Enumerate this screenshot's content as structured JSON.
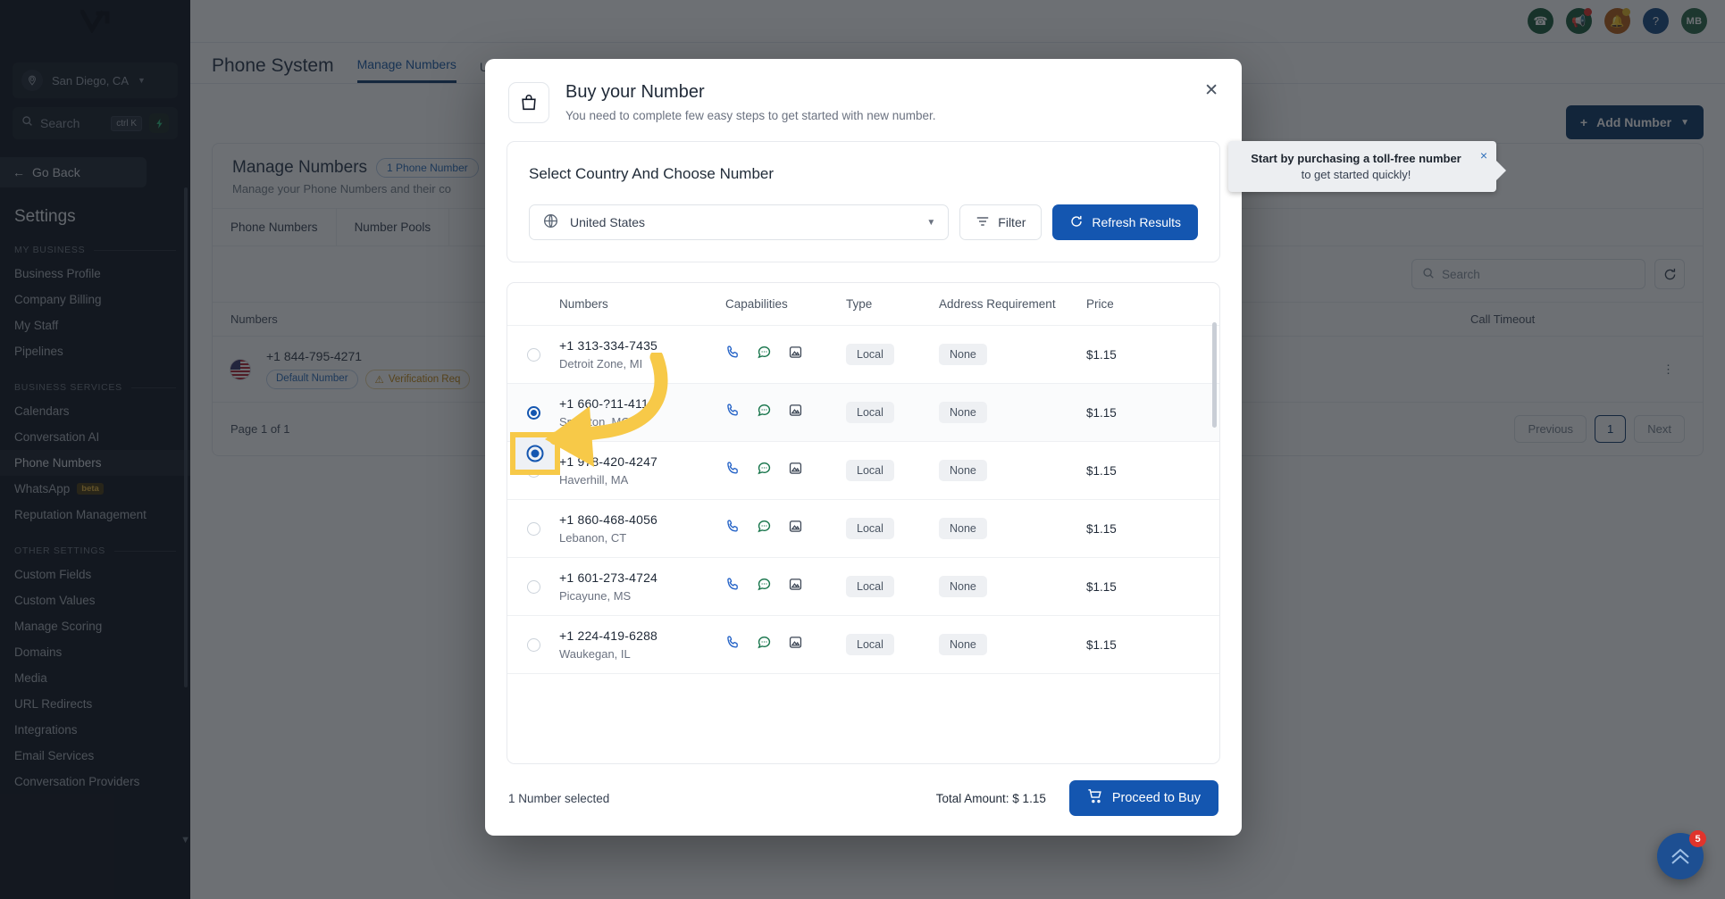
{
  "sidebar": {
    "location": "San Diego, CA",
    "search_placeholder": "Search",
    "search_kbd": "ctrl K",
    "go_back": "Go Back",
    "title": "Settings",
    "groups": [
      {
        "label": "MY BUSINESS",
        "items": [
          "Business Profile",
          "Company Billing",
          "My Staff",
          "Pipelines"
        ]
      },
      {
        "label": "BUSINESS SERVICES",
        "items": [
          "Calendars",
          "Conversation AI",
          "Phone Numbers",
          "WhatsApp",
          "Reputation Management"
        ]
      },
      {
        "label": "OTHER SETTINGS",
        "items": [
          "Custom Fields",
          "Custom Values",
          "Manage Scoring",
          "Domains",
          "Media",
          "URL Redirects",
          "Integrations",
          "Email Services",
          "Conversation Providers"
        ]
      }
    ],
    "active_item": "Phone Numbers",
    "beta_label": "beta",
    "beta_on": "WhatsApp"
  },
  "header": {
    "icons": [
      {
        "name": "phone-icon",
        "glyph": "☎",
        "bg": "#1f5c3e"
      },
      {
        "name": "megaphone-icon",
        "glyph": "📢",
        "bg": "#1f5c3e",
        "dot": "#e0342c"
      },
      {
        "name": "bell-icon",
        "glyph": "🔔",
        "bg": "#b5601a",
        "dot": "#e8b828"
      },
      {
        "name": "help-icon",
        "glyph": "?",
        "bg": "#1b4c85"
      }
    ],
    "avatar_initials": "MB"
  },
  "page": {
    "title": "Phone System",
    "tabs": [
      "Manage Numbers",
      "Us"
    ],
    "active_tab": "Manage Numbers",
    "card_title": "Manage Numbers",
    "card_pill": "1 Phone Number",
    "card_subtitle": "Manage your Phone Numbers and their co",
    "subtabs": [
      "Phone Numbers",
      "Number Pools"
    ],
    "search_placeholder": "Search",
    "add_number_label": "Add Number",
    "table_headers": [
      "Numbers",
      "Call Timeout"
    ],
    "row": {
      "number": "+1 844-795-4271",
      "badge_default": "Default Number",
      "badge_warning": "Verification Req"
    },
    "page_info": "Page 1 of 1",
    "pagination": {
      "previous": "Previous",
      "current": "1",
      "next": "Next"
    }
  },
  "callout": {
    "line1": "Start by purchasing a toll-free number",
    "line2": "to get started quickly!",
    "close": "×"
  },
  "modal": {
    "title": "Buy your Number",
    "subtitle": "You need to complete few easy steps to get started with new number.",
    "close": "✕",
    "section_title": "Select Country And Choose Number",
    "country": "United States",
    "filter_label": "Filter",
    "refresh_label": "Refresh Results",
    "table": {
      "headers": [
        "Numbers",
        "Capabilities",
        "Type",
        "Address Requirement",
        "Price"
      ],
      "rows": [
        {
          "selected": false,
          "number": "+1 313-334-7435",
          "location": "Detroit Zone, MI",
          "capabilities": [
            "voice-icon",
            "sms-icon",
            "mms-icon"
          ],
          "type": "Local",
          "address": "None",
          "price": "$1.15"
        },
        {
          "selected": true,
          "number": "+1 660-?11-411?",
          "location": "Smithton, MO",
          "capabilities": [
            "voice-icon",
            "sms-icon",
            "mms-icon"
          ],
          "type": "Local",
          "address": "None",
          "price": "$1.15"
        },
        {
          "selected": false,
          "number": "+1 978-420-4247",
          "location": "Haverhill, MA",
          "capabilities": [
            "voice-icon",
            "sms-icon",
            "mms-icon"
          ],
          "type": "Local",
          "address": "None",
          "price": "$1.15"
        },
        {
          "selected": false,
          "number": "+1 860-468-4056",
          "location": "Lebanon, CT",
          "capabilities": [
            "voice-icon",
            "sms-icon",
            "mms-icon"
          ],
          "type": "Local",
          "address": "None",
          "price": "$1.15"
        },
        {
          "selected": false,
          "number": "+1 601-273-4724",
          "location": "Picayune, MS",
          "capabilities": [
            "voice-icon",
            "sms-icon",
            "mms-icon"
          ],
          "type": "Local",
          "address": "None",
          "price": "$1.15"
        },
        {
          "selected": false,
          "number": "+1 224-419-6288",
          "location": "Waukegan, IL",
          "capabilities": [
            "voice-icon",
            "sms-icon",
            "mms-icon"
          ],
          "type": "Local",
          "address": "None",
          "price": "$1.15"
        }
      ]
    },
    "footer": {
      "selected_text": "1 Number selected",
      "total_label": "Total Amount: $ 1.15",
      "buy_label": "Proceed to Buy"
    }
  },
  "fab": {
    "badge": "5"
  },
  "colors": {
    "accent_blue": "#1456b0",
    "dark_navy": "#123a68",
    "highlight_yellow": "#f7c948",
    "arrow_yellow": "#f7c948",
    "voice_icon": "#2563c7",
    "sms_icon": "#16744a",
    "mms_icon": "#3b4554"
  }
}
